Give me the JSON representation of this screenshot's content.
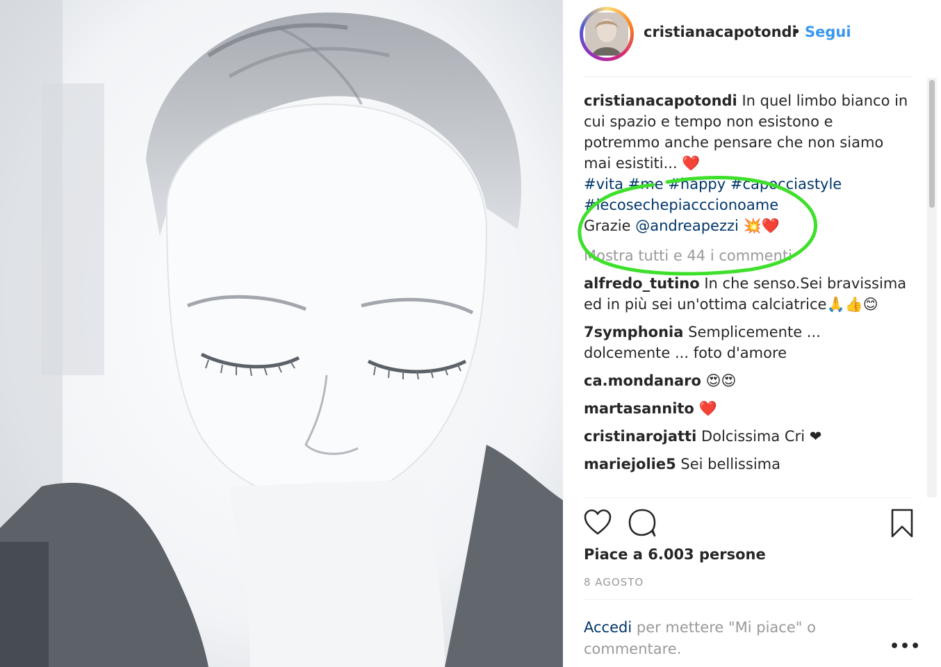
{
  "post": {
    "author": "cristianacapotondi",
    "separator": "•",
    "follow_label": "Segui"
  },
  "caption": {
    "username": "cristianacapotondi",
    "text": "In quel limbo bianco in cui spazio e tempo non esistono e potremmo anche pensare che non siamo mai esistiti...",
    "emoji": "❤️",
    "hashtags": [
      "#vita",
      "#me",
      "#happy",
      "#capocciastyle",
      "#lecosechepiacccionoame"
    ],
    "thanks_prefix": "Grazie",
    "mention": "@andreapezzi",
    "thanks_emoji_1": "💥",
    "thanks_emoji_2": "❤️"
  },
  "view_all_comments": "Mostra tutti e 44 i commenti",
  "comments": [
    {
      "username": "alfredo_tutino",
      "text": "In che senso.Sei bravissima ed in più sei un'ottima calciatrice",
      "emoji": "🙏👍😊"
    },
    {
      "username": "7symphonia",
      "text": "Semplicemente ... dolcemente ... foto d'amore",
      "emoji": ""
    },
    {
      "username": "ca.mondanaro",
      "text": "",
      "emoji": "😍😍"
    },
    {
      "username": "martasannito",
      "text": "",
      "emoji": "❤️"
    },
    {
      "username": "cristinarojatti",
      "text": "Dolcissima Cri",
      "emoji": "❤"
    },
    {
      "username": "mariejolie5",
      "text": "Sei bellissima",
      "emoji": ""
    }
  ],
  "actions": {
    "like_icon": "heart-outline-icon",
    "comment_icon": "speech-bubble-icon",
    "save_icon": "bookmark-icon"
  },
  "likes_text": "Piace a 6.003 persone",
  "date_text": "8 AGOSTO",
  "login_prompt": {
    "link": "Accedi",
    "text": "per mettere \"Mi piace\" o commentare."
  },
  "more_label": "•••",
  "colors": {
    "link": "#3897f0",
    "hashtag": "#003569",
    "muted": "#999999",
    "annotation": "#3ee02b"
  }
}
